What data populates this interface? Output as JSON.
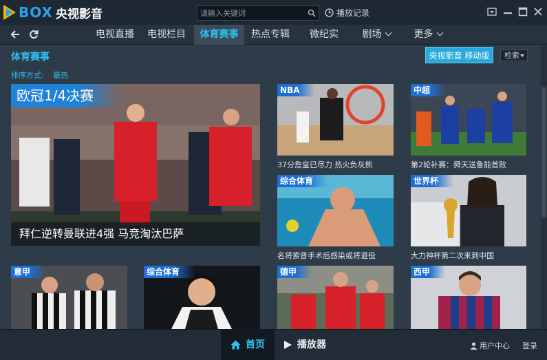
{
  "app": {
    "logo_box": "BOX",
    "logo_cn": "央视影音"
  },
  "titlebar": {
    "search_placeholder": "请输入关键词",
    "history_label": "播放记录"
  },
  "nav": {
    "tabs": [
      {
        "label": "电视直播"
      },
      {
        "label": "电视栏目"
      },
      {
        "label": "体育赛事"
      },
      {
        "label": "热点专辑"
      },
      {
        "label": "微纪实"
      },
      {
        "label": "剧场"
      },
      {
        "label": "更多"
      }
    ],
    "active_index": 2
  },
  "content": {
    "section_title": "体育赛事",
    "mobile_button": "央视影音 移动版",
    "filter_label": "检索",
    "sort_label": "排序方式:",
    "sort_value": "最热",
    "featured": {
      "category": "欧冠1/4决赛",
      "caption": "拜仁逆转曼联进4强 马竞淘汰巴萨"
    },
    "tiles": [
      {
        "category": "NBA",
        "caption": "37分詹皇已尽力 热火负灰熊"
      },
      {
        "category": "中超",
        "caption": "第2轮补赛：舜天送鲁能首败"
      },
      {
        "category": "综合体育",
        "caption": "名将索普手术后感染或将退役"
      },
      {
        "category": "世界杯",
        "caption": "大力神杯第二次来到中国"
      },
      {
        "category": "意甲",
        "caption": ""
      },
      {
        "category": "综合体育",
        "caption": ""
      },
      {
        "category": "德甲",
        "caption": ""
      },
      {
        "category": "西甲",
        "caption": ""
      }
    ]
  },
  "footer": {
    "home_label": "首页",
    "player_label": "播放器",
    "user_center_label": "用户中心",
    "login_label": "登录"
  },
  "colors": {
    "accent": "#2ec0f2",
    "category_blue": "#1d6fd6",
    "background": "#2e3b48"
  }
}
